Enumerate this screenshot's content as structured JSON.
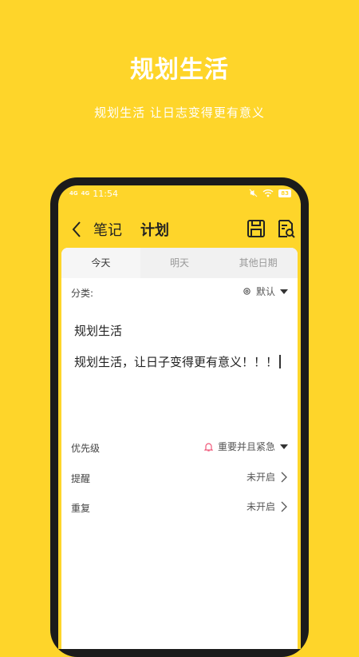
{
  "promo": {
    "title": "规划生活",
    "subtitle": "规划生活 让日志变得更有意义"
  },
  "statusbar": {
    "signal1": "4G",
    "signal2": "4G",
    "time": "11:54",
    "battery": "83"
  },
  "appbar": {
    "note_label": "笔记",
    "plan_label": "计划"
  },
  "tabs": [
    {
      "label": "今天"
    },
    {
      "label": "明天"
    },
    {
      "label": "其他日期"
    }
  ],
  "category": {
    "label": "分类:",
    "value": "默认"
  },
  "plan": {
    "title": "规划生活",
    "content": "规划生活，让日子变得更有意义！！！"
  },
  "settings": {
    "priority": {
      "label": "优先级",
      "value": "重要并且紧急"
    },
    "reminder": {
      "label": "提醒",
      "value": "未开启"
    },
    "repeat": {
      "label": "重复",
      "value": "未开启"
    }
  },
  "colors": {
    "background": "#FED52A",
    "bell": "#F0597A"
  }
}
